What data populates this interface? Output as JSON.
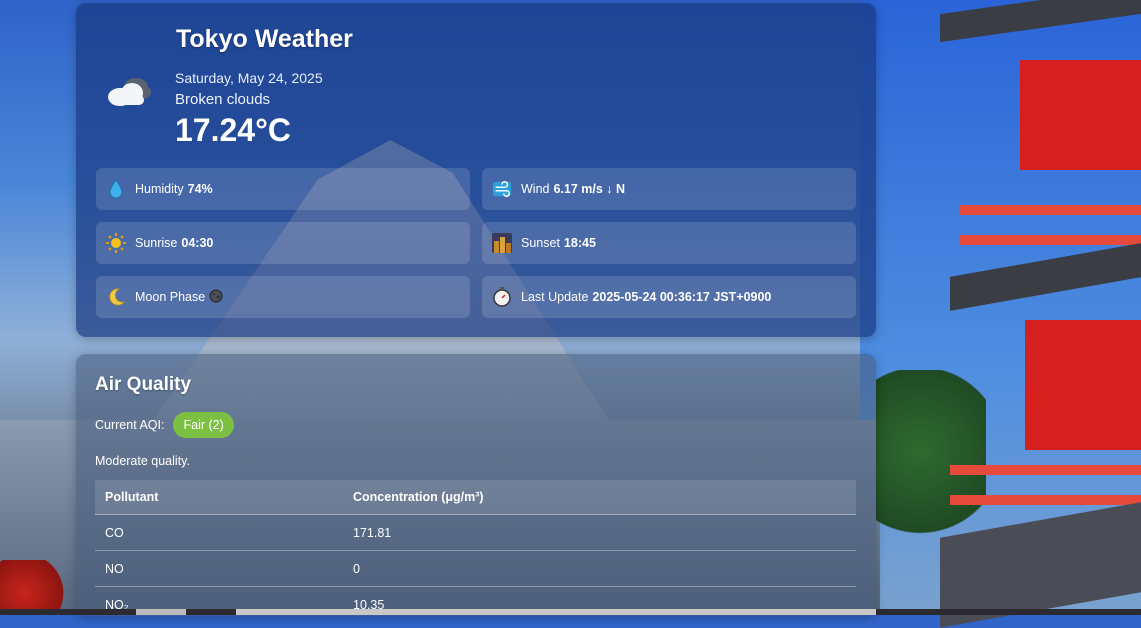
{
  "weather": {
    "title": "Tokyo Weather",
    "date": "Saturday, May 24, 2025",
    "description": "Broken clouds",
    "temperature": "17.24°C",
    "icon": "broken-clouds-icon",
    "details": {
      "humidity": {
        "label": "Humidity",
        "value": "74%",
        "icon": "droplet-icon"
      },
      "wind": {
        "label": "Wind",
        "value": "6.17 m/s ↓ N",
        "icon": "wind-icon"
      },
      "sunrise": {
        "label": "Sunrise",
        "value": "04:30",
        "icon": "sunrise-icon"
      },
      "sunset": {
        "label": "Sunset",
        "value": "18:45",
        "icon": "sunset-icon"
      },
      "moon": {
        "label": "Moon Phase",
        "value": "🌑",
        "icon": "crescent-moon-icon"
      },
      "update": {
        "label": "Last Update",
        "value": "2025-05-24 00:36:17 JST+0900",
        "icon": "stopwatch-icon"
      }
    }
  },
  "air_quality": {
    "title": "Air Quality",
    "current_label": "Current AQI:",
    "badge": "Fair (2)",
    "badge_color": "#7cc043",
    "note": "Moderate quality.",
    "columns": [
      "Pollutant",
      "Concentration (μg/m³)"
    ],
    "rows": [
      {
        "pollutant": "CO",
        "value": "171.81"
      },
      {
        "pollutant": "NO",
        "value": "0"
      },
      {
        "pollutant": "NO₂",
        "value": "10.35"
      }
    ]
  }
}
